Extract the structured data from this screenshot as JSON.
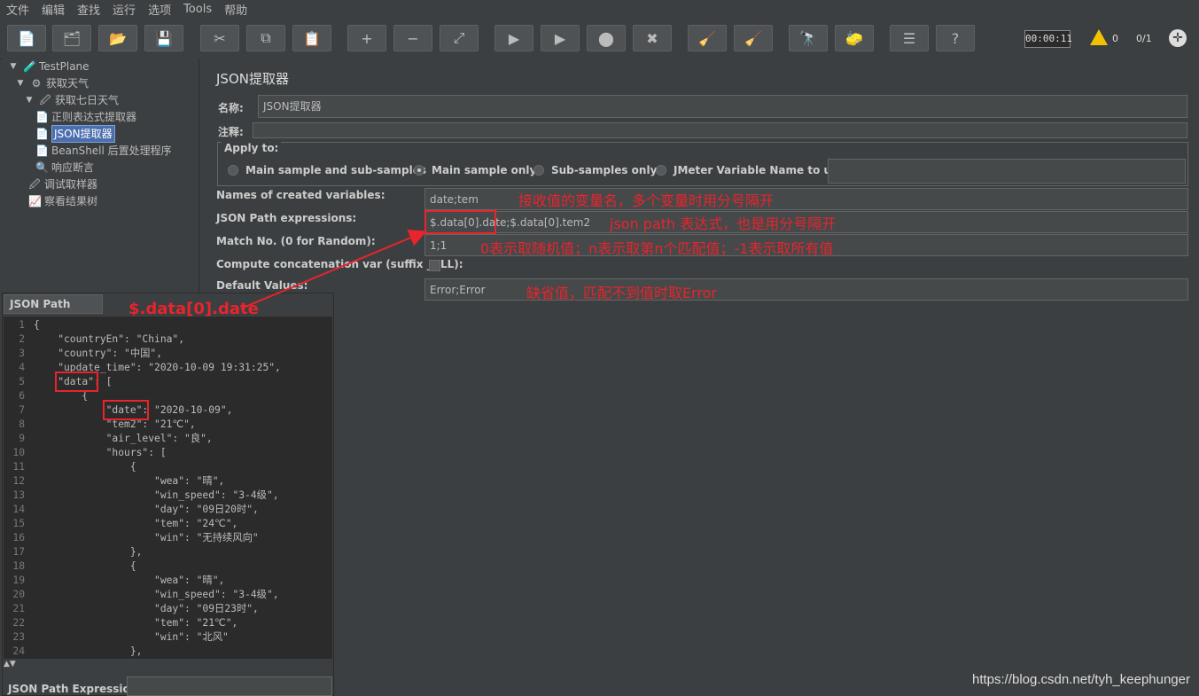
{
  "menu": [
    "文件",
    "编辑",
    "查找",
    "运行",
    "选项",
    "Tools",
    "帮助"
  ],
  "toolbar": {
    "buttons": [
      {
        "name": "new-icon",
        "glyph": "📄"
      },
      {
        "name": "templates-icon",
        "glyph": "🗂"
      },
      {
        "name": "open-icon",
        "glyph": "📂"
      },
      {
        "name": "save-icon",
        "glyph": "💾"
      },
      {
        "name": "cut-icon",
        "glyph": "✂"
      },
      {
        "name": "copy-icon",
        "glyph": "⧉"
      },
      {
        "name": "paste-icon",
        "glyph": "📋"
      },
      {
        "name": "expand-icon",
        "glyph": "+"
      },
      {
        "name": "collapse-icon",
        "glyph": "−"
      },
      {
        "name": "toggle-icon",
        "glyph": "⤢"
      },
      {
        "name": "start-icon",
        "glyph": "▶"
      },
      {
        "name": "start-no-pause-icon",
        "glyph": "▶"
      },
      {
        "name": "stop-icon",
        "glyph": "⬤"
      },
      {
        "name": "shutdown-icon",
        "glyph": "✖"
      },
      {
        "name": "clear-icon",
        "glyph": "🧹"
      },
      {
        "name": "clear-all-icon",
        "glyph": "🧹"
      },
      {
        "name": "search-icon",
        "glyph": "🔭"
      },
      {
        "name": "reset-search-icon",
        "glyph": "🧽"
      },
      {
        "name": "function-helper-icon",
        "glyph": "☰"
      },
      {
        "name": "help-icon",
        "glyph": "?"
      }
    ],
    "timer": "00:00:11",
    "warnings": "0",
    "threads": "0/1"
  },
  "tree": [
    {
      "label": "TestPlane",
      "icon": "testplan-icon"
    },
    {
      "label": "获取天气",
      "icon": "thread-group-icon"
    },
    {
      "label": "获取七日天气",
      "icon": "sampler-icon"
    },
    {
      "label": "正则表达式提取器",
      "icon": "extractor-icon"
    },
    {
      "label": "JSON提取器",
      "icon": "extractor-icon"
    },
    {
      "label": "BeanShell 后置处理程序",
      "icon": "postprocessor-icon"
    },
    {
      "label": "响应断言",
      "icon": "assertion-icon"
    },
    {
      "label": "调试取样器",
      "icon": "sampler-icon"
    },
    {
      "label": "察看结果树",
      "icon": "listener-icon"
    }
  ],
  "panel": {
    "title": "JSON提取器",
    "name_label": "名称:",
    "name_value": "JSON提取器",
    "comment_label": "注释:",
    "apply_to": "Apply to:",
    "radios": [
      "Main sample and sub-samples",
      "Main sample only",
      "Sub-samples only",
      "JMeter Variable Name to use"
    ],
    "selected_radio": "Main sample only",
    "fields": [
      {
        "label": "Names of created variables:",
        "value": "date;tem"
      },
      {
        "label": "JSON Path expressions:",
        "value": "$.data[0].date;$.data[0].tem2"
      },
      {
        "label": "Match No. (0 for Random):",
        "value": "1;1"
      },
      {
        "label": "Compute concatenation var (suffix _ALL):",
        "value": ""
      },
      {
        "label": "Default Values:",
        "value": "Error;Error"
      }
    ]
  },
  "annotations": {
    "variables": "接收值的变量名，多个变量时用分号隔开",
    "expressions": "json path 表达式，也是用分号隔开",
    "match": "0表示取随机值；n表示取第n个匹配值；-1表示取所有值",
    "defaults": "缺省值，匹配不到值时取Error",
    "path_example": "$.data[0].date",
    "color": "#e8242c"
  },
  "tester": {
    "tab": "JSON Path Tester",
    "expression_label": "JSON Path Expression",
    "lines": [
      "{",
      "    \"countryEn\": \"China\",",
      "    \"country\": \"中国\",",
      "    \"update_time\": \"2020-10-09 19:31:25\",",
      "    \"data\": [",
      "        {",
      "            \"date\": \"2020-10-09\",",
      "            \"tem2\": \"21℃\",",
      "            \"air_level\": \"良\",",
      "            \"hours\": [",
      "                {",
      "                    \"wea\": \"晴\",",
      "                    \"win_speed\": \"3-4级\",",
      "                    \"day\": \"09日20时\",",
      "                    \"tem\": \"24℃\",",
      "                    \"win\": \"无持续风向\"",
      "                },",
      "                {",
      "                    \"wea\": \"晴\",",
      "                    \"win_speed\": \"3-4级\",",
      "                    \"day\": \"09日23时\",",
      "                    \"tem\": \"21℃\",",
      "                    \"win\": \"北风\"",
      "                },"
    ]
  },
  "watermark": "https://blog.csdn.net/tyh_keephunger"
}
